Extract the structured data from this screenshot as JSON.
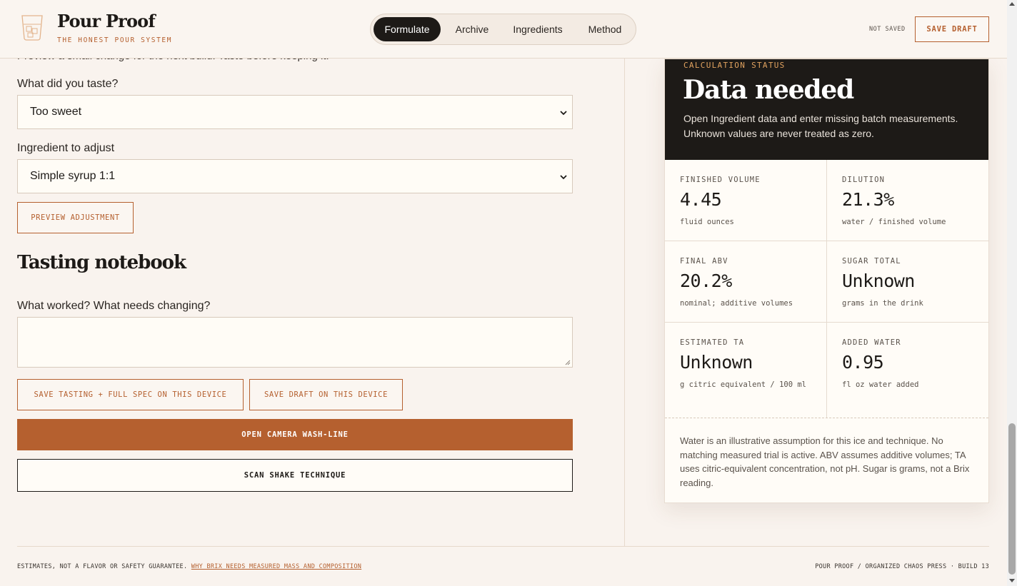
{
  "brand": {
    "name": "Pour Proof",
    "tagline": "THE HONEST POUR SYSTEM"
  },
  "nav": {
    "tabs": [
      {
        "label": "Formulate",
        "active": true
      },
      {
        "label": "Archive",
        "active": false
      },
      {
        "label": "Ingredients",
        "active": false
      },
      {
        "label": "Method",
        "active": false
      }
    ]
  },
  "header": {
    "save_status": "NOT SAVED",
    "save_draft_label": "SAVE DRAFT"
  },
  "adjust": {
    "intro": "Preview a small change for the next build. Taste before keeping it.",
    "taste_label": "What did you taste?",
    "taste_value": "Too sweet",
    "ingredient_label": "Ingredient to adjust",
    "ingredient_value": "Simple syrup 1:1",
    "preview_label": "PREVIEW ADJUSTMENT"
  },
  "notebook": {
    "title": "Tasting notebook",
    "prompt": "What worked? What needs changing?",
    "text_value": "",
    "save_tasting_label": "SAVE TASTING + FULL SPEC ON THIS DEVICE",
    "save_draft_label": "SAVE DRAFT ON THIS DEVICE",
    "camera_label": "OPEN CAMERA WASH-LINE",
    "scan_label": "SCAN SHAKE TECHNIQUE"
  },
  "panel": {
    "status_kicker": "CALCULATION STATUS",
    "status_title": "Data needed",
    "status_text": "Open Ingredient data and enter missing batch measurements. Unknown values are never treated as zero.",
    "metrics": [
      {
        "label": "FINISHED VOLUME",
        "value": "4.45",
        "sub": "fluid ounces"
      },
      {
        "label": "DILUTION",
        "value": "21.3%",
        "sub": "water / finished volume"
      },
      {
        "label": "FINAL ABV",
        "value": "20.2%",
        "sub": "nominal; additive volumes"
      },
      {
        "label": "SUGAR TOTAL",
        "value": "Unknown",
        "sub": "grams in the drink"
      },
      {
        "label": "ESTIMATED TA",
        "value": "Unknown",
        "sub": "g citric equivalent / 100 ml"
      },
      {
        "label": "ADDED WATER",
        "value": "0.95",
        "sub": "fl oz water added"
      }
    ],
    "note": "Water is an illustrative assumption for this ice and technique. No matching measured trial is active. ABV assumes additive volumes; TA uses citric-equivalent concentration, not pH. Sugar is grams, not a Brix reading."
  },
  "footer": {
    "left_text": "ESTIMATES, NOT A FLAVOR OR SAFETY GUARANTEE.",
    "left_link": "WHY BRIX NEEDS MEASURED MASS AND COMPOSITION",
    "right_text": "POUR PROOF / ORGANIZED CHAOS PRESS · BUILD 13"
  },
  "colors": {
    "accent": "#b5602f",
    "ink": "#1d1a17",
    "background": "#f9f3ee",
    "status_kicker": "#e0a25f"
  },
  "icons": {
    "logo": "rocks-glass-icon",
    "select_caret": "chevron-down-icon"
  }
}
